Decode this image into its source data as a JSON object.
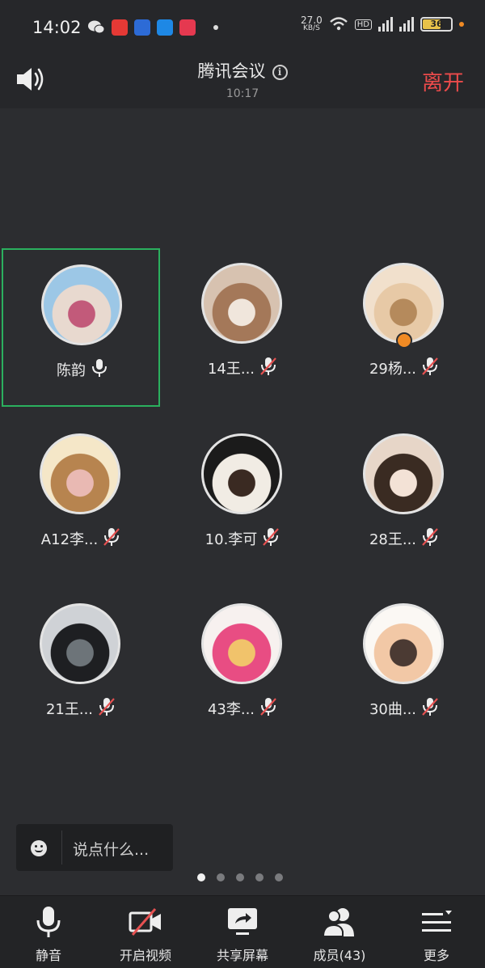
{
  "status_bar": {
    "time": "14:02",
    "net_speed_value": "27.0",
    "net_speed_unit": "KB/S",
    "hd_label": "HD",
    "battery": "36",
    "app_colors": [
      "#2dc100",
      "#e53935",
      "#2d6bd6",
      "#1e88e5",
      "#e53950"
    ]
  },
  "header": {
    "title": "腾讯会议",
    "duration": "10:17",
    "leave_label": "离开"
  },
  "participants": [
    {
      "name": "陈韵",
      "muted": false,
      "active": true,
      "host": false,
      "avatar_colors": [
        "#9cc7e6",
        "#e8d9cf",
        "#c25a7a"
      ]
    },
    {
      "name": "14王...",
      "muted": true,
      "active": false,
      "host": false,
      "avatar_colors": [
        "#d7c2b0",
        "#a47859",
        "#f0e6dc"
      ]
    },
    {
      "name": "29杨...",
      "muted": true,
      "active": false,
      "host": true,
      "avatar_colors": [
        "#f1e0cc",
        "#e7c9a6",
        "#b58a5c"
      ]
    },
    {
      "name": "A12李...",
      "muted": true,
      "active": false,
      "host": false,
      "avatar_colors": [
        "#f5e7c8",
        "#b7844f",
        "#e9b9b3"
      ]
    },
    {
      "name": "10.李可",
      "muted": true,
      "active": false,
      "host": false,
      "avatar_colors": [
        "#1b1b1b",
        "#f1ece4",
        "#3a2a22"
      ]
    },
    {
      "name": "28王...",
      "muted": true,
      "active": false,
      "host": false,
      "avatar_colors": [
        "#e7d6c8",
        "#3a2b22",
        "#f3e2d6"
      ]
    },
    {
      "name": "21王...",
      "muted": true,
      "active": false,
      "host": false,
      "avatar_colors": [
        "#cfd2d6",
        "#1e1f22",
        "#6d7479"
      ]
    },
    {
      "name": "43李...",
      "muted": true,
      "active": false,
      "host": false,
      "avatar_colors": [
        "#f7f1ef",
        "#e84d83",
        "#f1c36b"
      ]
    },
    {
      "name": "30曲...",
      "muted": true,
      "active": false,
      "host": false,
      "avatar_colors": [
        "#fbf8f4",
        "#f2c8a6",
        "#4b3a33"
      ]
    }
  ],
  "chat": {
    "placeholder": "说点什么..."
  },
  "pagination": {
    "count": 5,
    "current": 1
  },
  "toolbar": {
    "mute_label": "静音",
    "video_label": "开启视频",
    "share_label": "共享屏幕",
    "members_label": "成员(43)",
    "more_label": "更多"
  },
  "colors": {
    "background": "#2c2d30",
    "accent_leave": "#ec4b4b",
    "active_speaker_border": "#2bb05e",
    "muted_slash": "#e65151",
    "host_badge": "#f08a24"
  }
}
